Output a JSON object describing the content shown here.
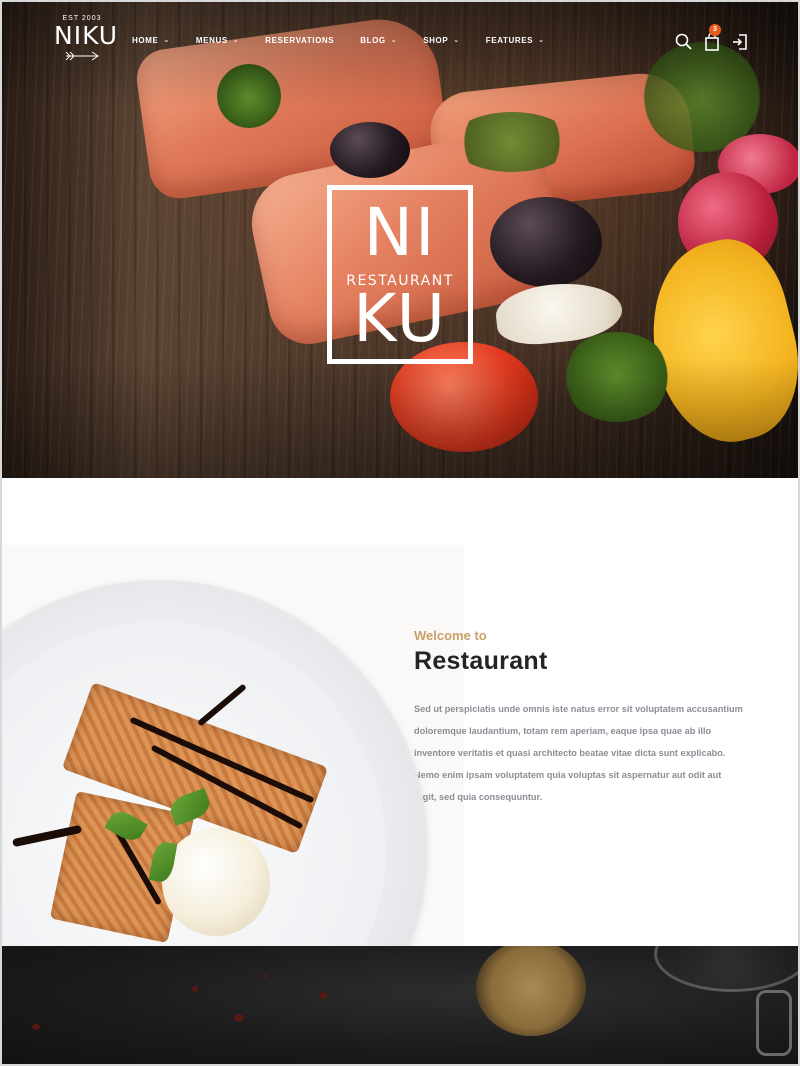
{
  "header": {
    "logo": {
      "est": "EST 2003",
      "name": "NIKU"
    },
    "nav": [
      {
        "label": "HOME",
        "has_dropdown": true
      },
      {
        "label": "MENUS",
        "has_dropdown": true
      },
      {
        "label": "RESERVATIONS",
        "has_dropdown": false
      },
      {
        "label": "BLOG",
        "has_dropdown": true
      },
      {
        "label": "SHOP",
        "has_dropdown": true
      },
      {
        "label": "FEATURES",
        "has_dropdown": true
      }
    ],
    "actions": {
      "search_icon": "search-icon",
      "cart_icon": "shopping-bag-icon",
      "cart_count": "3",
      "login_icon": "sign-in-icon"
    }
  },
  "hero": {
    "emblem_top": "NI",
    "emblem_middle": "RESTAURANT",
    "emblem_bottom": "KU"
  },
  "welcome": {
    "kicker": "Welcome to",
    "title": "Restaurant",
    "body": "Sed ut perspiciatis unde omnis iste natus error sit voluptatem accusantium doloremque laudantium, totam rem aperiam, eaque ipsa quae ab illo inventore veritatis et quasi architecto beatae vitae dicta sunt explicabo. Nemo enim ipsam voluptatem quia voluptas sit aspernatur aut odit aut fugit, sed quia consequuntur."
  },
  "colors": {
    "accent": "#c9a06a",
    "badge": "#e85a1b",
    "heading": "#242424",
    "body_text": "#8a8f96"
  }
}
